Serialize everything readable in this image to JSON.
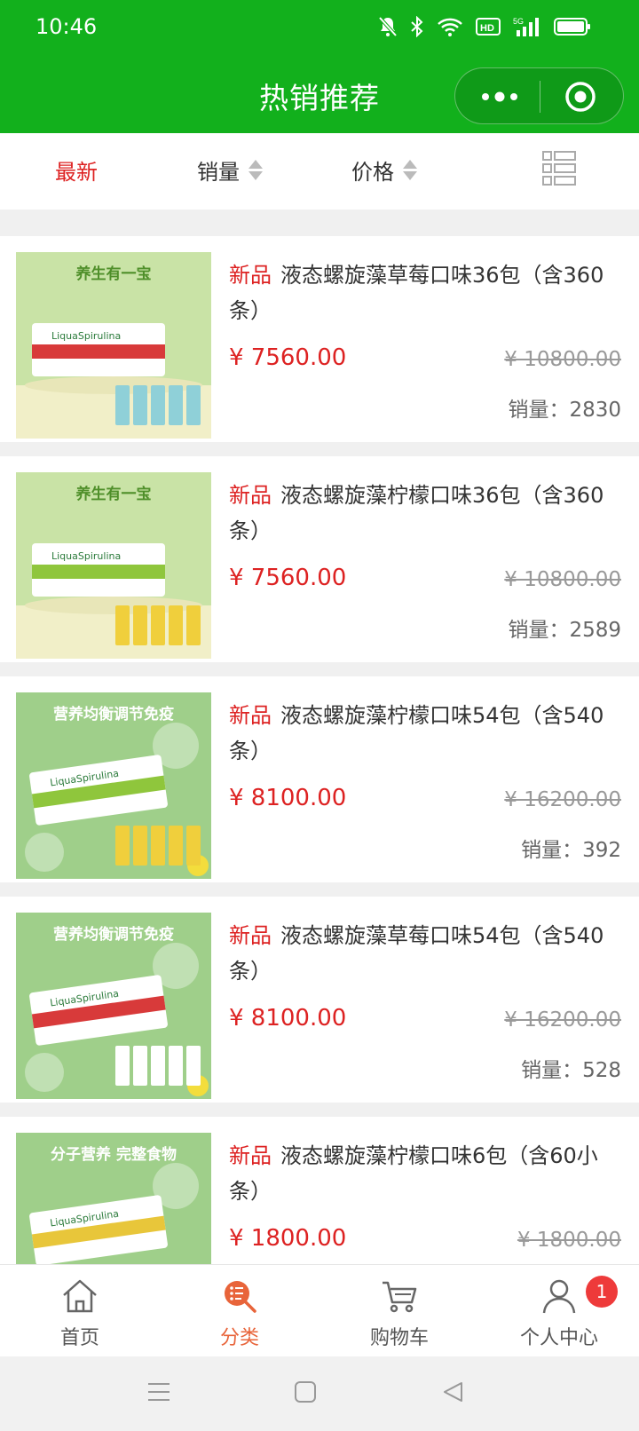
{
  "status_bar": {
    "time": "10:46"
  },
  "header": {
    "title": "热销推荐"
  },
  "sort_bar": {
    "newest": "最新",
    "sales": "销量",
    "price": "价格"
  },
  "products": [
    {
      "tag": "新品",
      "name": "液态螺旋藻草莓口味36包（含360条）",
      "price": "¥ 7560.00",
      "original_price": "¥ 10800.00",
      "sales": "销量：2830",
      "thumb_title": "养生有一宝",
      "thumb_brand": "LiquaSpirulina",
      "flavor_color": "#d83a3a"
    },
    {
      "tag": "新品",
      "name": "液态螺旋藻柠檬口味36包（含360条）",
      "price": "¥ 7560.00",
      "original_price": "¥ 10800.00",
      "sales": "销量：2589",
      "thumb_title": "养生有一宝",
      "thumb_brand": "LiquaSpirulina",
      "flavor_color": "#8fc63c"
    },
    {
      "tag": "新品",
      "name": "液态螺旋藻柠檬口味54包（含540条）",
      "price": "¥ 8100.00",
      "original_price": "¥ 16200.00",
      "sales": "销量：392",
      "thumb_title": "营养均衡调节免疫",
      "thumb_brand": "LiquaSpirulina",
      "flavor_color": "#8fc63c"
    },
    {
      "tag": "新品",
      "name": "液态螺旋藻草莓口味54包（含540条）",
      "price": "¥ 8100.00",
      "original_price": "¥ 16200.00",
      "sales": "销量：528",
      "thumb_title": "营养均衡调节免疫",
      "thumb_brand": "LiquaSpirulina",
      "flavor_color": "#d83a3a"
    },
    {
      "tag": "新品",
      "name": "液态螺旋藻柠檬口味6包（含60小条）",
      "price": "¥ 1800.00",
      "original_price": "¥ 1800.00",
      "sales": "",
      "thumb_title": "分子营养 完整食物",
      "thumb_brand": "LiquaSpirulina",
      "flavor_color": "#e8c63a"
    }
  ],
  "tabbar": {
    "home": "首页",
    "category": "分类",
    "cart": "购物车",
    "profile": "个人中心",
    "profile_badge": "1"
  },
  "colors": {
    "brand_green": "#12b01c",
    "accent_red": "#dd2222",
    "active_tab": "#e8643a"
  }
}
